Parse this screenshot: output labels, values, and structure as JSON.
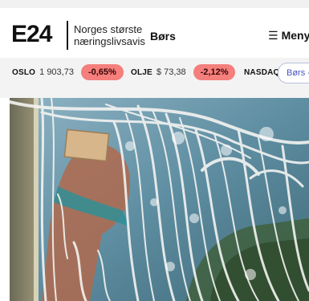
{
  "brand": {
    "logo_text": "E24",
    "tagline_line1": "Norges største",
    "tagline_line2": "næringslivsavis"
  },
  "nav": {
    "section": "Børs",
    "menu_label": "Meny",
    "menu_icon": "hamburger-icon"
  },
  "ticker": {
    "items": [
      {
        "label": "OSLO",
        "value": "1 903,73",
        "change": "-0,65%"
      },
      {
        "label": "OLJE",
        "value": "$ 73,38",
        "change": "-2,12%"
      },
      {
        "label": "NASDAQ",
        "value": "",
        "change": ""
      }
    ],
    "bors_button": "Børs -",
    "negative_color": "#f47f7c"
  },
  "hero_image": {
    "subject": "window-washing-photo"
  }
}
